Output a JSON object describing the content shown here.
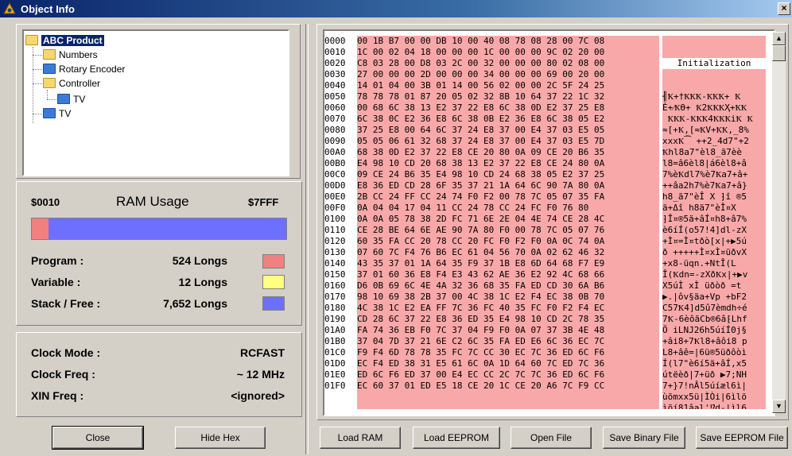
{
  "window": {
    "title": "Object Info",
    "close_glyph": "×"
  },
  "tree": {
    "items": [
      {
        "label": "ABC Product",
        "color": "yellow",
        "selected": true
      },
      {
        "label": "Numbers",
        "color": "yellow"
      },
      {
        "label": "Rotary Encoder",
        "color": "blue"
      },
      {
        "label": "Controller",
        "color": "yellow"
      },
      {
        "label": "TV",
        "color": "blue"
      },
      {
        "label": "TV",
        "color": "blue"
      }
    ]
  },
  "ram": {
    "start_addr": "$0010",
    "title": "RAM Usage",
    "end_addr": "$7FFF",
    "used_fraction": 0.065,
    "rows": [
      {
        "label": "Program :",
        "value": "524 Longs",
        "color": "#f28080"
      },
      {
        "label": "Variable :",
        "value": "12 Longs",
        "color": "#ffff80"
      },
      {
        "label": "Stack / Free :",
        "value": "7,652 Longs",
        "color": "#6e6eff"
      }
    ]
  },
  "clock": {
    "rows": [
      {
        "label": "Clock Mode :",
        "value": "RCFAST"
      },
      {
        "label": "Clock Freq :",
        "value": "~ 12 MHz"
      },
      {
        "label": "XIN Freq :",
        "value": "<ignored>"
      }
    ]
  },
  "hex": {
    "ascii_header": "Initialization",
    "addresses": [
      "0000",
      "0010",
      "0020",
      "0030",
      "0040",
      "0050",
      "0060",
      "0070",
      "0080",
      "0090",
      "00A0",
      "00B0",
      "00C0",
      "00D0",
      "00E0",
      "00F0",
      "0100",
      "0110",
      "0120",
      "0130",
      "0140",
      "0150",
      "0160",
      "0170",
      "0180",
      "0190",
      "01A0",
      "01B0",
      "01C0",
      "01D0",
      "01E0",
      "01F0"
    ],
    "rows": [
      "00 1B B7 00 00 DB 10 00 40 08 78 08 28 00 7C 08",
      "1C 00 02 04 18 00 00 00 1C 00 00 00 9C 02 20 00",
      "C8 03 28 00 D8 03 2C 00 32 00 00 00 80 02 08 00",
      "27 00 00 00 2D 00 00 00 34 00 00 00 69 00 20 00",
      "14 01 04 00 3B 01 14 00 56 02 00 00 2C 5F 24 25",
      "78 78 78 01 87 20 05 02 32 8B 10 64 37 22 1C 32",
      "00 68 6C 38 13 E2 37 22 E8 6C 38 0D E2 37 25 E8",
      "6C 38 0C E2 36 E8 6C 38 0B E2 36 E8 6C 38 05 E2",
      "37 25 E8 00 64 6C 37 24 E8 37 00 E4 37 03 E5 05",
      "05 05 06 61 32 68 37 24 E8 37 00 E4 37 03 E5 7D",
      "68 38 0D E2 37 22 E8 CE 20 80 0A 09 CE 20 B6 35",
      "E4 98 10 CD 20 68 38 13 E2 37 22 E8 CE 24 80 0A",
      "09 CE 24 B6 35 E4 98 10 CD 24 68 38 05 E2 37 25",
      "E8 36 ED CD 28 6F 35 37 21 1A 64 6C 90 7A 80 0A",
      "2B CC 24 FF CC 24 74 F0 F2 00 78 7C 05 07 35 FA",
      "0A 04 04 17 04 11 CC 24 78 CC 24 FC F0 76 80",
      "0A 0A 05 78 38 2D FC 71 6E 2E 04 4E 74 CE 28 4C",
      "CE 28 BE 64 6E AE 90 7A 80 F0 00 78 7C 05 07 76",
      "60 35 FA CC 20 78 CC 20 FC F0 F2 F0 0A 0C 74 0A",
      "07 60 7C F4 76 B6 EC 61 04 56 70 0A 02 62 46 32",
      "43 35 37 01 1A 64 35 F9 37 1B E8 6D 64 68 F7 E9",
      "37 01 60 36 E8 F4 E3 43 62 AE 36 E2 92 4C 68 66",
      "D6 0B 69 6C 4E 4A 32 36 68 35 FA ED CD 30 6A B6",
      "98 10 69 38 2B 37 00 4C 38 1C E2 F4 EC 38 0B 70",
      "4C 38 1C E2 EA FF 7C 36 FC 40 35 FC F0 F2 F4 EC",
      "CD 28 6C 37 22 E8 36 ED 35 E4 98 10 CD 2C 78 35",
      "FA 74 36 EB F0 7C 37 04 F9 F0 0A 07 37 3B 4E 48",
      "37 04 7D 37 21 6E C2 6C 35 FA ED E6 6C 36 EC 7C",
      "F9 F4 6D 78 78 35 FC 7C CC 30 EC 7C 36 ED 6C F6",
      "EC F4 ED 38 31 E5 61 6C 0A 1D 64 60 7C ED 7C 36",
      "ED 6C F6 ED 37 00 E4 EC CC 2C 7C 7C 36 ED 6C F6",
      "EC 60 37 01 ED E5 18 CE 20 1C CE 20 A6 7C F9 CC"
    ],
    "ascii_rows": [
      "╢Ҟ+†ҞҞҞ-ҞҞҞ+ Ҟ",
      "È+⁄ҞӨ+ Ҟ2ҞҞҞҲ+ҞҞ",
      " ҞҞҞ-ҞҞҞ4ҞҞҞiҞ Ҟ",
      "≈[+Ҟ,[≈ҞV+ҞҞ,_8%",
      "xxxҞ⁀ ++2_4d7\"+2",
      "Ҟhl8a7\"èl8_ã7èè",
      "l8=â6èl8|á6èl8+â",
      "7%èҞdl7%è7Ҟa7+â+",
      "++âa2h7%è7Ҟa7+â}",
      "h8_ã7\"èÎ X ⁆î ®5",
      "ä+Δî h8ä7\"èÎ¤X",
      "⁆Î¤®5ä+âÍ¤h8+â7%",
      "è6íÍ(o57!4]dl-zX",
      "+Ì¤=Ì¤tðò[x|+▶5ú",
      "ð +++++Ì¤xÌ¤üðvX",
      "+x8-üqn.+NtÎ(L",
      "Î(Ҟdn=-zXðҞx|+▶v",
      "X5úÌ xÌ üðòð =t",
      "▶.|ôv§äa+Vp +bF2",
      "C57Ҟ4]d5û7èmdh÷é",
      "7Ҟ-6èôãCb®6â⁅Lhf",
      "Ö iLNJ26h5úíÍ0j§",
      "+âi8+7Ҟl8+âôi8 p",
      "L8+âê=|6ü®5üðôòì",
      "Í(l7\"è6í5ä+âÍ,x5",
      "útëèð|7+üð ▶7;NH",
      "7+}7!nÂl5úíæl6ì|",
      "ùõmxx5ü|ÌÒi|6ìlö",
      "ìõí81âal'⁉d-|ìl6",
      "íì6ì7Ҟäìî,||6ìlö",
      "ì-7[iâ+î ⁆î ⁅|ùÌ",
      ""
    ]
  },
  "buttons": {
    "close": "Close",
    "hide_hex": "Hide Hex",
    "load_ram": "Load RAM",
    "load_eeprom": "Load EEPROM",
    "open_file": "Open File",
    "save_binary": "Save Binary File",
    "save_eeprom": "Save EEPROM File"
  }
}
